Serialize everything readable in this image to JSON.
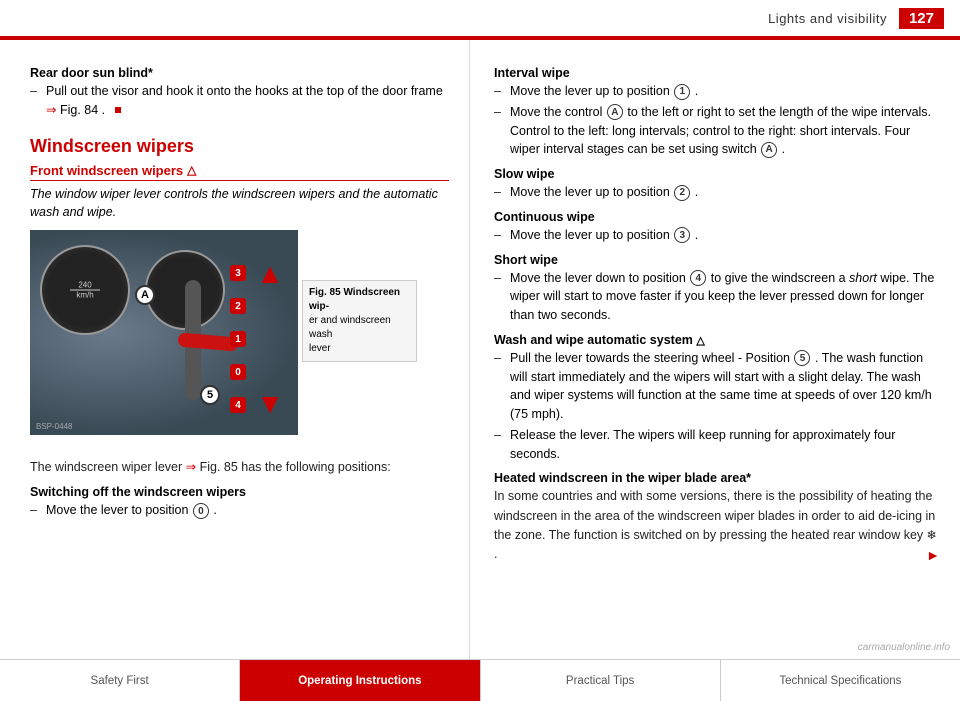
{
  "header": {
    "title": "Lights and visibility",
    "page_number": "127"
  },
  "left_column": {
    "rear_door_section": {
      "heading": "Rear door sun blind*",
      "bullet": "Pull out the visor and hook it onto the hooks at the top of the door frame",
      "ref": "Fig. 84"
    },
    "windscreen_section": {
      "heading": "Windscreen wipers",
      "subsection": "Front windscreen wipers",
      "italic_text": "The window wiper lever controls the windscreen wipers and the automatic wash and wipe.",
      "fig_label": "Fig. 85",
      "fig_caption_title": "Fig. 85  Windscreen wip-",
      "fig_caption_line2": "er and windscreen wash",
      "fig_caption_line3": "lever",
      "fig_ref_text": "The windscreen wiper lever",
      "fig_ref": "Fig. 85",
      "fig_ref_suffix": "has the following positions:",
      "switching_off_heading": "Switching off the windscreen wipers",
      "switching_off_bullet": "Move the lever to position",
      "switching_off_pos": "0"
    }
  },
  "right_column": {
    "interval_wipe": {
      "heading": "Interval wipe",
      "bullet1_pre": "Move the lever up to position",
      "bullet1_pos": "1",
      "bullet2_pre": "Move the control",
      "bullet2_letter": "A",
      "bullet2_text": "to the left or right to set the length of the wipe intervals. Control to the left: long intervals; control to the right: short intervals. Four wiper interval stages can be set using switch",
      "bullet2_letter2": "A"
    },
    "slow_wipe": {
      "heading": "Slow wipe",
      "bullet_pre": "Move the lever up to position",
      "bullet_pos": "2"
    },
    "continuous_wipe": {
      "heading": "Continuous wipe",
      "bullet_pre": "Move the lever up to position",
      "bullet_pos": "3"
    },
    "short_wipe": {
      "heading": "Short wipe",
      "bullet_pre": "Move the lever down to position",
      "bullet_pos": "4",
      "bullet_text_mid": "to give the windscreen a",
      "bullet_italic": "short",
      "bullet_text_end": "wipe. The wiper will start to move faster if you keep the lever pressed down for longer than two seconds."
    },
    "wash_wipe": {
      "heading": "Wash and wipe automatic system",
      "bullet1_pre": "Pull the lever towards the steering wheel - Position",
      "bullet1_pos": "5",
      "bullet1_text": ". The wash function will start immediately and the wipers will start with a slight delay. The wash and wiper systems will function at the same time at speeds of over 120 km/h (75 mph).",
      "bullet2_text": "Release the lever. The wipers will keep running for approximately four seconds."
    },
    "heated_section": {
      "heading": "Heated windscreen in the wiper blade area*",
      "text": "In some countries and with some versions, there is the possibility of heating the windscreen in the area of the windscreen wiper blades in order to aid de-icing in the zone. The function is switched on by pressing the heated rear window key"
    }
  },
  "footer": {
    "items": [
      {
        "label": "Safety First",
        "active": false
      },
      {
        "label": "Operating Instructions",
        "active": true
      },
      {
        "label": "Practical Tips",
        "active": false
      },
      {
        "label": "Technical Specifications",
        "active": false
      }
    ]
  },
  "watermark": "carmanualonline.info"
}
